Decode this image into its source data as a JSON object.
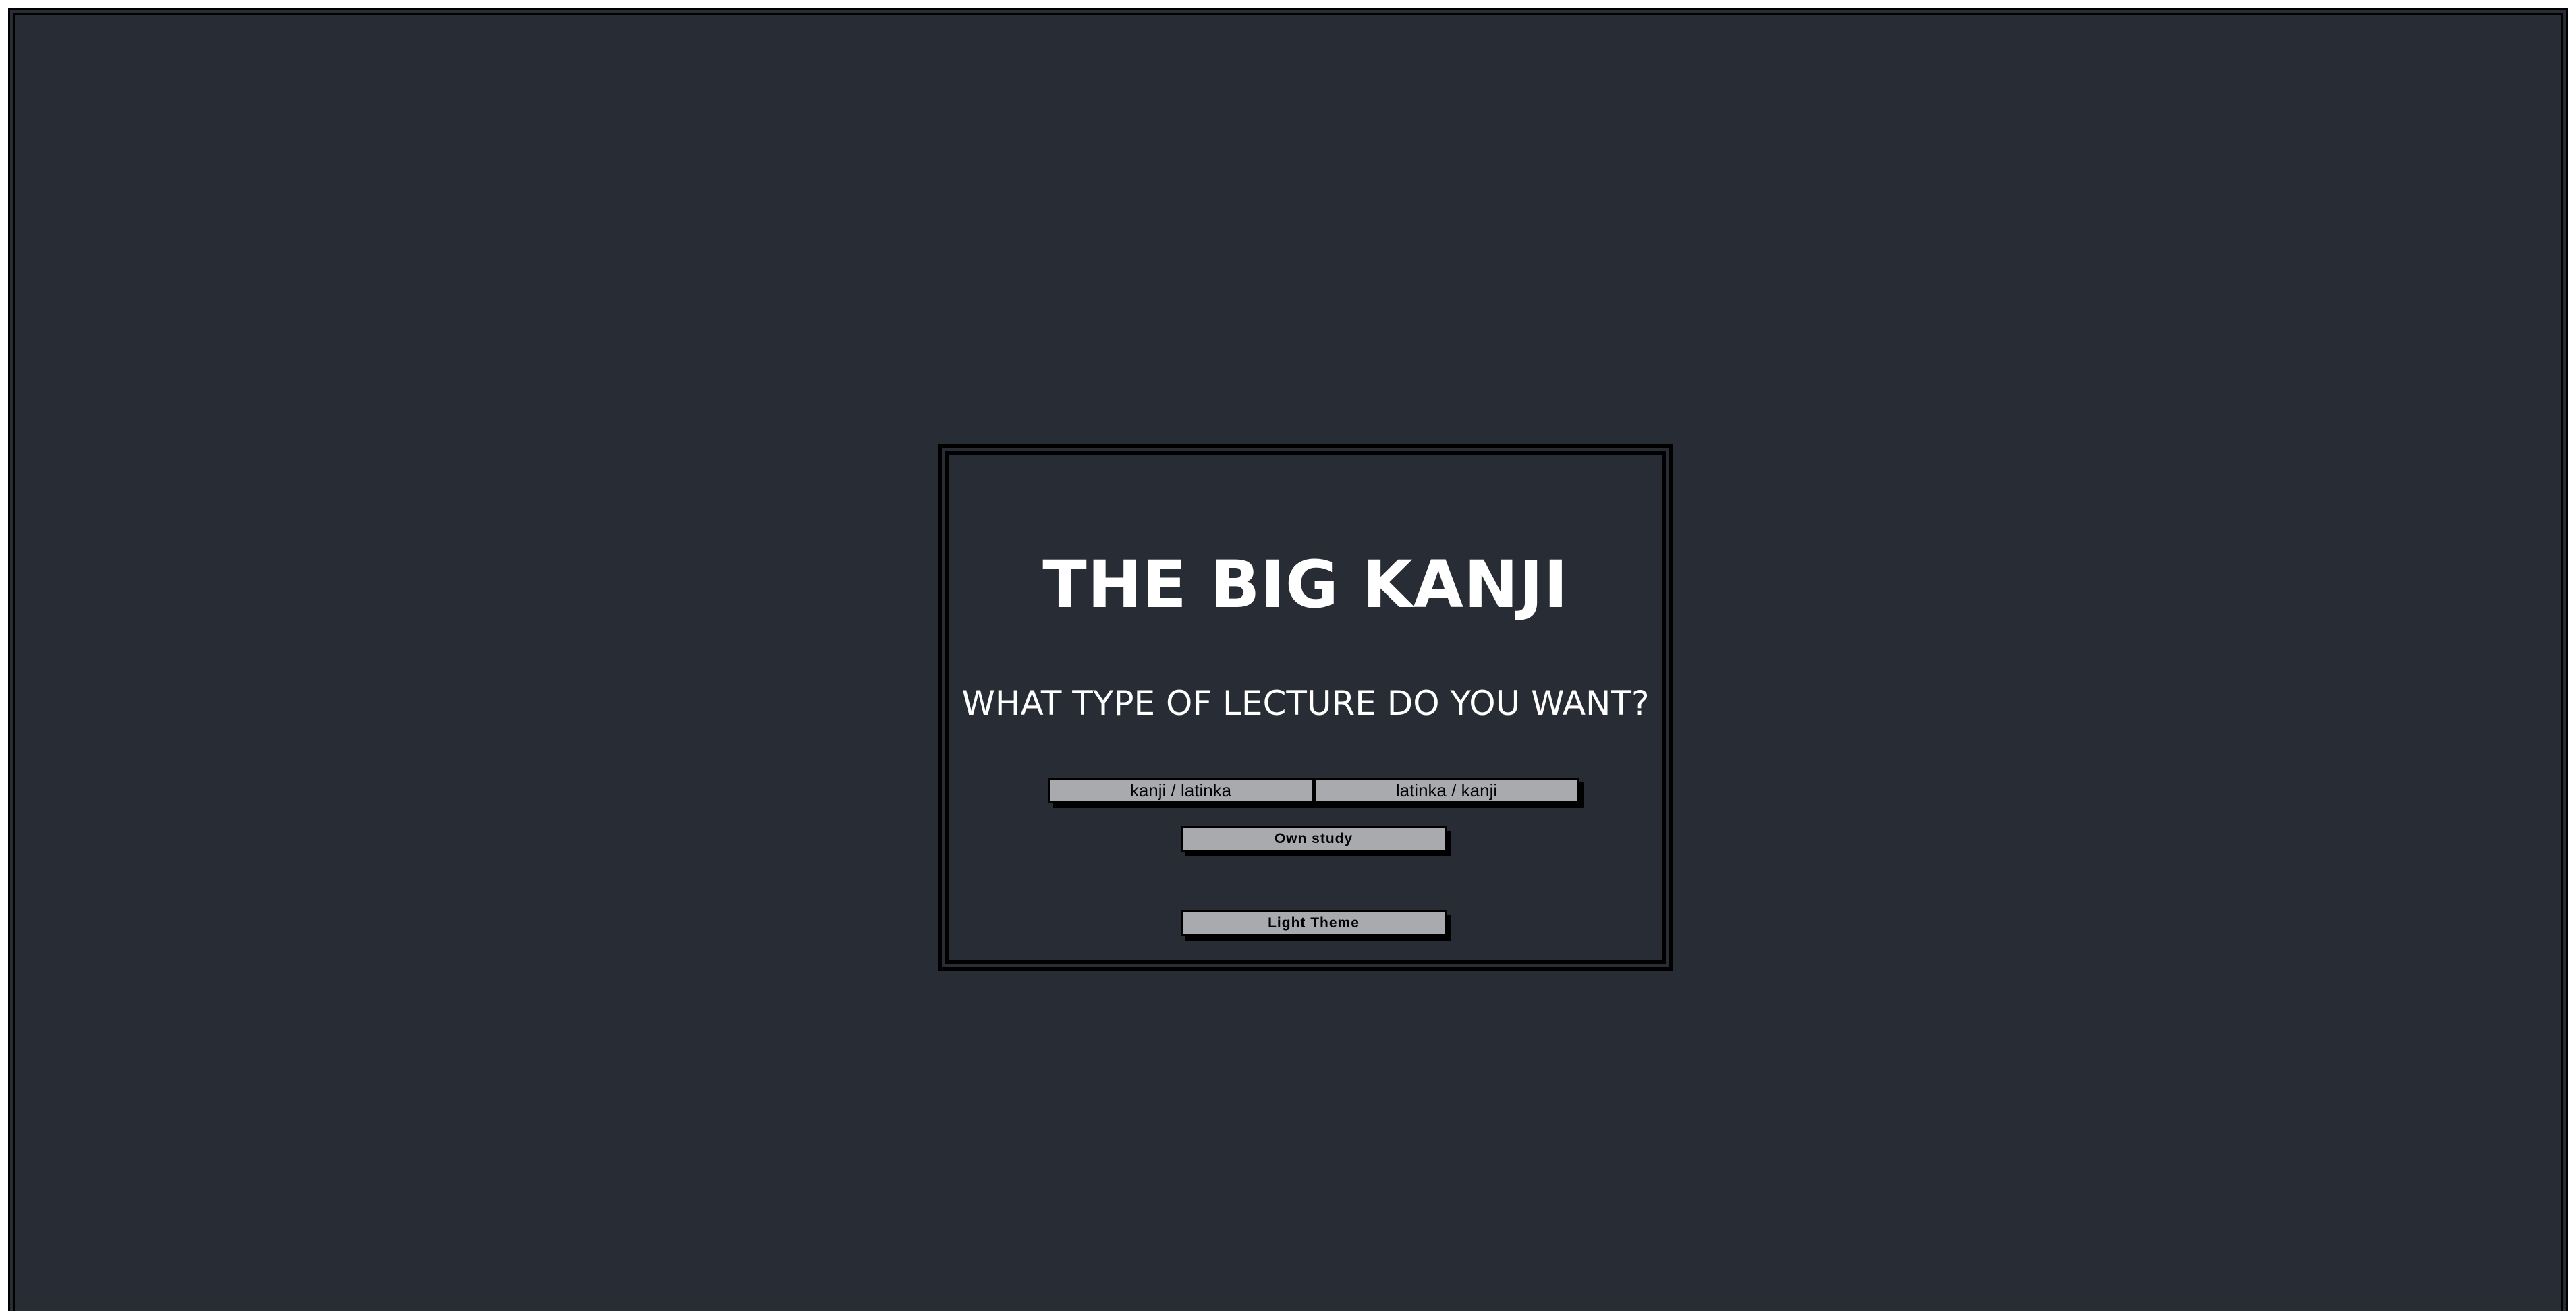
{
  "menu": {
    "title": "THE BIG KANJI",
    "question": "WHAT TYPE OF LECTURE DO YOU WANT?",
    "buttons": {
      "kanji_latinka": "kanji / latinka",
      "latinka_kanji": "latinka / kanji",
      "own_study": "Own study",
      "light_theme": "Light Theme"
    }
  },
  "colors": {
    "background": "#282c34",
    "button": "#a9aaae",
    "text": "#ffffff",
    "border": "#000000"
  }
}
